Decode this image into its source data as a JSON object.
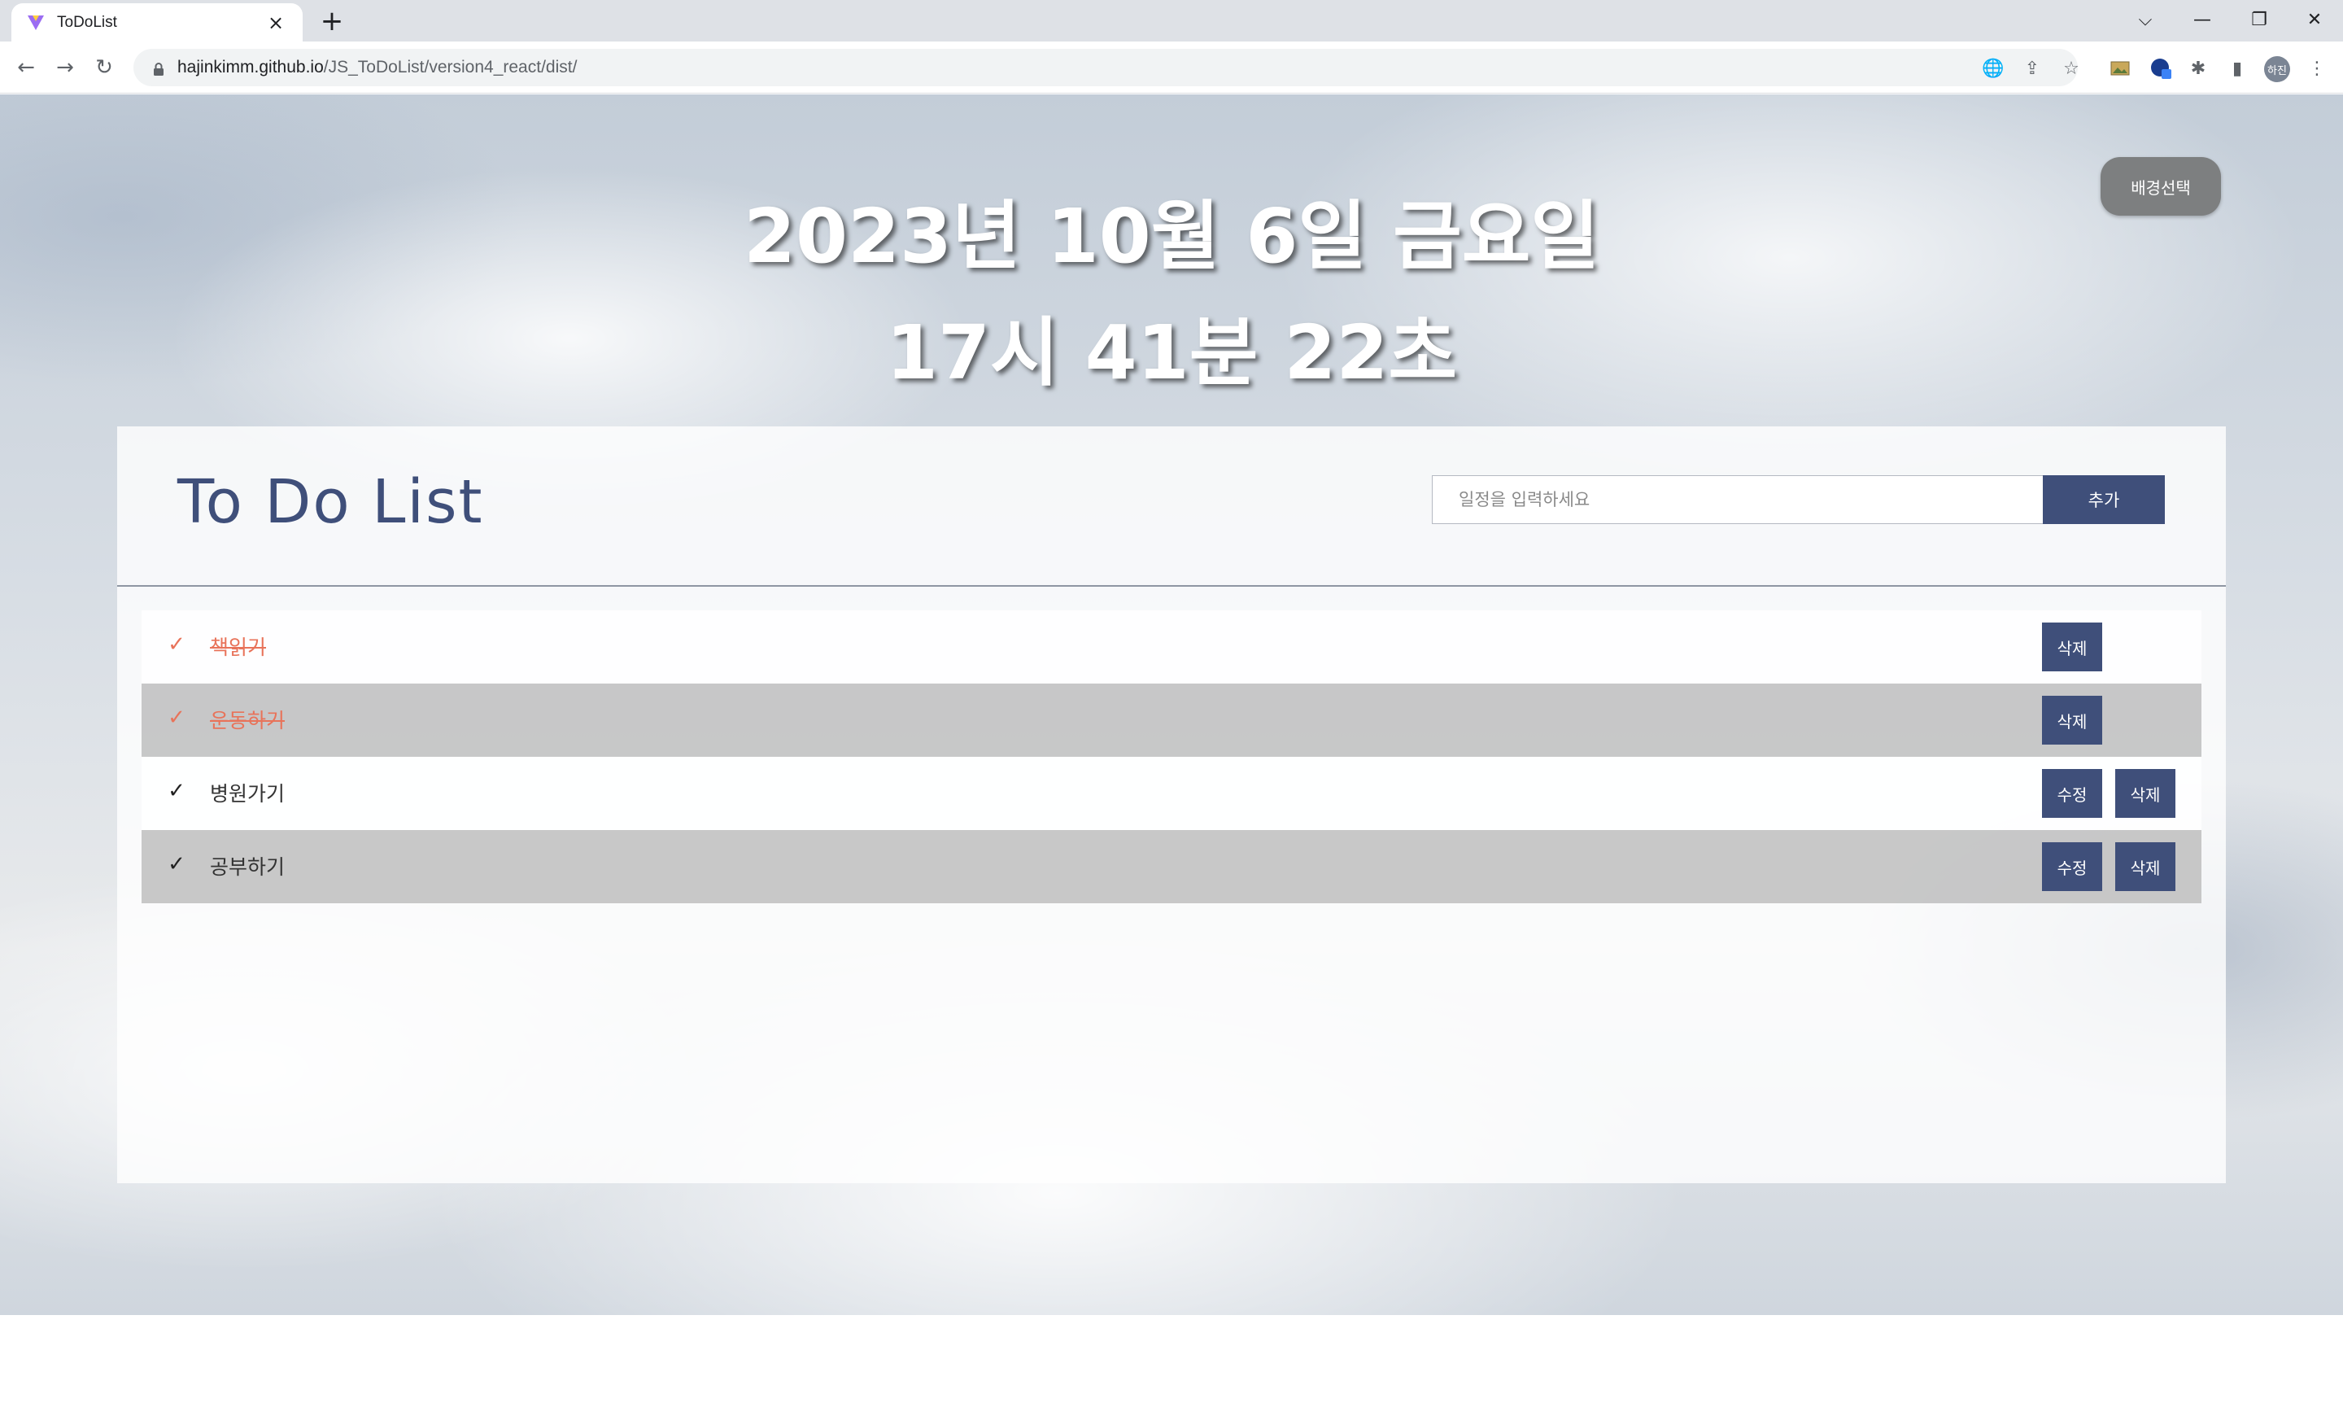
{
  "browser": {
    "tab_title": "ToDoList",
    "tab_close_glyph": "×",
    "new_tab_glyph": "+",
    "url_host": "hajinkimm.github.io",
    "url_path": "/JS_ToDoList/version4_react/dist/",
    "avatar_text": "하진",
    "window_controls": {
      "dropdown": "⌵",
      "minimize": "—",
      "restore": "❐",
      "close": "✕"
    },
    "icons": {
      "back": "←",
      "forward": "→",
      "reload": "↻",
      "translate": "🌐",
      "share": "⇪",
      "star": "☆",
      "puzzle": "✱",
      "sidepanel": "▮",
      "menu": "⋮"
    }
  },
  "page": {
    "date_text": "2023년 10월 6일 금요일",
    "time_text": "17시 41분 22초",
    "bg_button_label": "배경선택",
    "title": "To Do List",
    "input_placeholder": "일정을 입력하세요",
    "add_button_label": "추가",
    "check_glyph": "✓",
    "todos": [
      {
        "text": "책읽기",
        "done": true,
        "delete_label": "삭제"
      },
      {
        "text": "운동하기",
        "done": true,
        "delete_label": "삭제"
      },
      {
        "text": "병원가기",
        "done": false,
        "edit_label": "수정",
        "delete_label": "삭제"
      },
      {
        "text": "공부하기",
        "done": false,
        "edit_label": "수정",
        "delete_label": "삭제"
      }
    ]
  },
  "colors": {
    "accent": "#3f4f7a",
    "done_text": "#e8735a",
    "bg_button": "#7d7f80"
  }
}
